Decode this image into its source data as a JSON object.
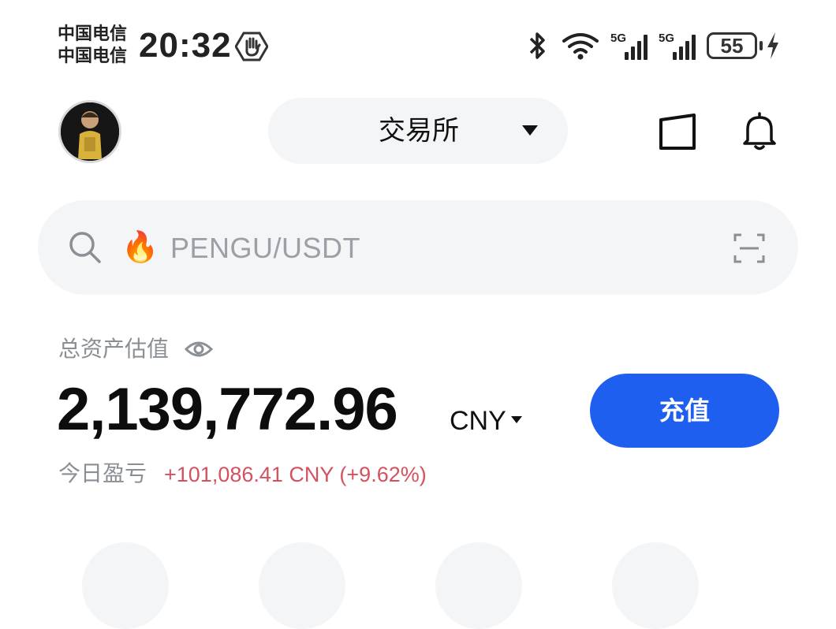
{
  "status_bar": {
    "carrier_1": "中国电信",
    "carrier_2": "中国电信",
    "time": "20:32",
    "signal_1": "5G",
    "signal_2": "5G",
    "battery": "55"
  },
  "header": {
    "selector_label": "交易所"
  },
  "search": {
    "placeholder": "PENGU/USDT"
  },
  "assets": {
    "label": "总资产估值",
    "value": "2,139,772.96",
    "currency": "CNY",
    "deposit_label": "充值",
    "pnl_label": "今日盈亏",
    "pnl_value": "+101,086.41 CNY (+9.62%)"
  },
  "colors": {
    "accent": "#1e5ff0",
    "pnl": "#d4515f",
    "pill_bg": "#f4f5f6"
  }
}
